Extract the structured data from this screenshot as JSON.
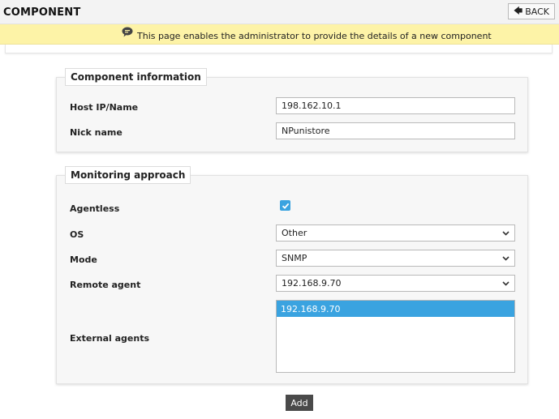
{
  "header": {
    "title": "COMPONENT",
    "back_label": "BACK"
  },
  "banner": {
    "text": "This page enables the administrator to provide the details of a new component"
  },
  "component_info": {
    "legend": "Component information",
    "host_label": "Host IP/Name",
    "host_value": "198.162.10.1",
    "nick_label": "Nick name",
    "nick_value": "NPunistore"
  },
  "monitoring": {
    "legend": "Monitoring approach",
    "agentless_label": "Agentless",
    "agentless_checked": true,
    "os_label": "OS",
    "os_value": "Other",
    "mode_label": "Mode",
    "mode_value": "SNMP",
    "remote_label": "Remote agent",
    "remote_value": "192.168.9.70",
    "external_label": "External agents",
    "external_items": [
      "192.168.9.70"
    ]
  },
  "actions": {
    "add_label": "Add"
  },
  "colors": {
    "accent": "#3aa3e0",
    "banner": "#fdf3a7",
    "button_dark": "#4a4a4a"
  },
  "icons": {
    "back": "back-arrow-icon",
    "banner": "chat-bubble-icon",
    "checkbox": "checkmark-icon",
    "select": "chevron-down-icon"
  }
}
